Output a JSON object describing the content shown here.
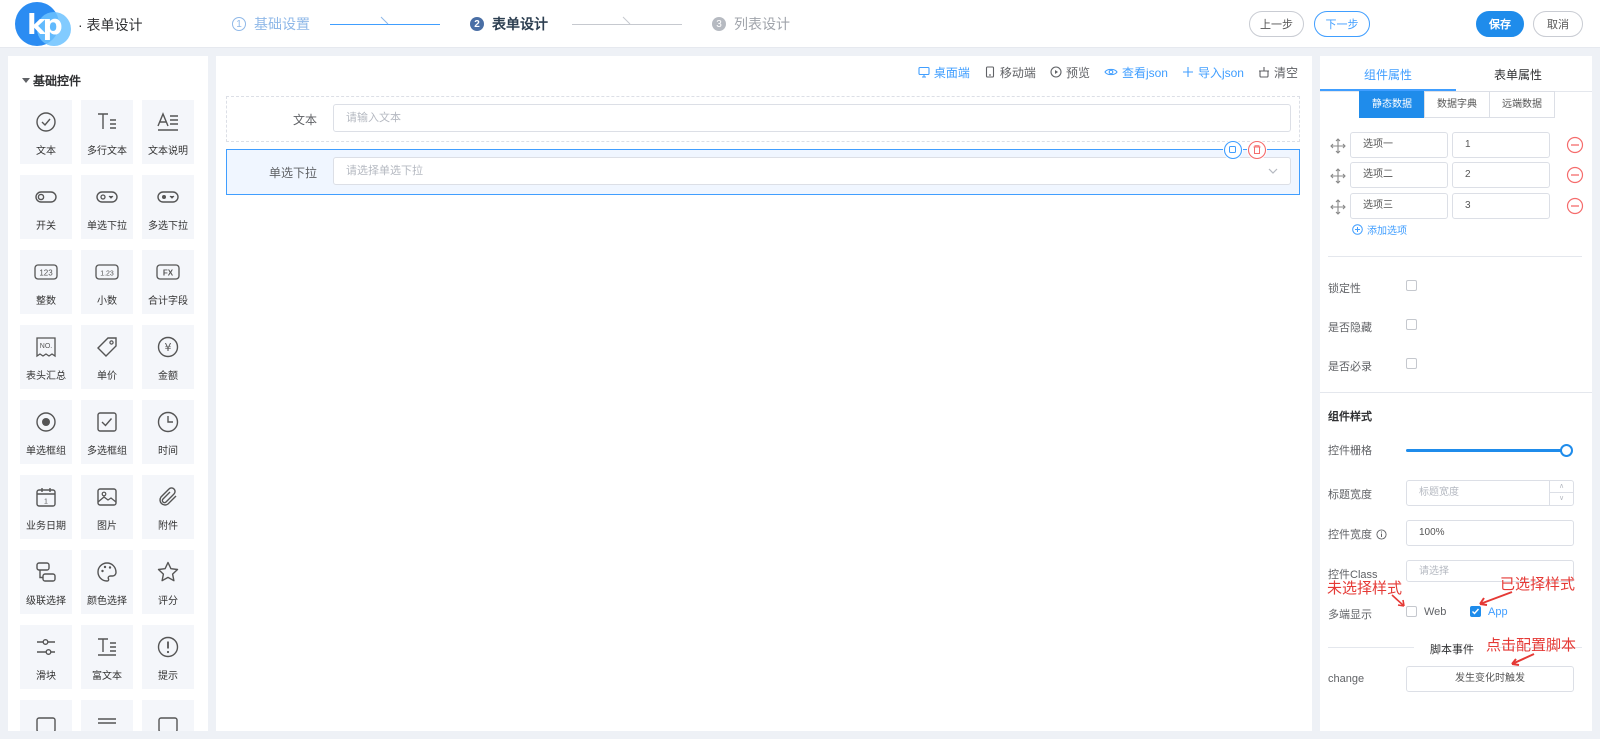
{
  "header": {
    "app_title": "· 表单设计",
    "steps": [
      {
        "num": "1",
        "label": "基础设置",
        "state": "done"
      },
      {
        "num": "2",
        "label": "表单设计",
        "state": "active"
      },
      {
        "num": "3",
        "label": "列表设计",
        "state": "todo"
      }
    ],
    "prev_label": "上一步",
    "next_label": "下一步",
    "save_label": "保存",
    "cancel_label": "取消"
  },
  "palette": {
    "title": "基础控件",
    "items": [
      {
        "label": "文本",
        "icon": "check-circle-icon"
      },
      {
        "label": "多行文本",
        "icon": "multiline-text-icon"
      },
      {
        "label": "文本说明",
        "icon": "text-description-icon"
      },
      {
        "label": "开关",
        "icon": "switch-icon"
      },
      {
        "label": "单选下拉",
        "icon": "single-select-icon"
      },
      {
        "label": "多选下拉",
        "icon": "multi-select-icon"
      },
      {
        "label": "整数",
        "icon": "integer-icon",
        "glyph": "123"
      },
      {
        "label": "小数",
        "icon": "decimal-icon",
        "glyph": "1.23"
      },
      {
        "label": "合计字段",
        "icon": "formula-icon",
        "glyph": "FX"
      },
      {
        "label": "表头汇总",
        "icon": "header-summary-icon",
        "glyph": "NO."
      },
      {
        "label": "单价",
        "icon": "price-tag-icon"
      },
      {
        "label": "金额",
        "icon": "yen-icon",
        "glyph": "¥"
      },
      {
        "label": "单选框组",
        "icon": "radio-icon"
      },
      {
        "label": "多选框组",
        "icon": "checkbox-icon"
      },
      {
        "label": "时间",
        "icon": "clock-icon"
      },
      {
        "label": "业务日期",
        "icon": "calendar-icon",
        "glyph": "1"
      },
      {
        "label": "图片",
        "icon": "image-icon"
      },
      {
        "label": "附件",
        "icon": "paperclip-icon"
      },
      {
        "label": "级联选择",
        "icon": "cascader-icon"
      },
      {
        "label": "颜色选择",
        "icon": "palette-icon"
      },
      {
        "label": "评分",
        "icon": "star-icon"
      },
      {
        "label": "滑块",
        "icon": "slider-icon"
      },
      {
        "label": "富文本",
        "icon": "rich-text-icon"
      },
      {
        "label": "提示",
        "icon": "alert-icon"
      }
    ]
  },
  "toolbar": {
    "desktop": "桌面端",
    "mobile": "移动端",
    "preview": "预览",
    "view_json": "查看json",
    "import_json": "导入json",
    "clear": "清空"
  },
  "canvas": {
    "fields": [
      {
        "label": "文本",
        "placeholder": "请输入文本",
        "selected": false
      },
      {
        "label": "单选下拉",
        "placeholder": "请选择单选下拉",
        "selected": true
      }
    ]
  },
  "props": {
    "tab_component": "组件属性",
    "tab_form": "表单属性",
    "seg_static": "静态数据",
    "seg_dict": "数据字典",
    "seg_remote": "远端数据",
    "options": [
      {
        "label": "选项一",
        "value": "1"
      },
      {
        "label": "选项二",
        "value": "2"
      },
      {
        "label": "选项三",
        "value": "3"
      }
    ],
    "add_option": "添加选项",
    "locked": "锁定性",
    "hidden": "是否隐藏",
    "required": "是否必录",
    "style_title": "组件样式",
    "grid": "控件栅格",
    "grid_value": 1.0,
    "label_width": "标题宽度",
    "label_width_ph": "标题宽度",
    "control_width": "控件宽度",
    "control_width_val": "100%",
    "control_class": "控件Class",
    "control_class_ph": "请选择",
    "multi_display": "多端显示",
    "web": "Web",
    "app": "App",
    "web_checked": false,
    "app_checked": true,
    "script_events": "脚本事件",
    "change": "change",
    "change_btn": "发生变化时触发"
  },
  "annotations": {
    "unselected": "未选择样式",
    "selected": "已选择样式",
    "config_script": "点击配置脚本"
  }
}
